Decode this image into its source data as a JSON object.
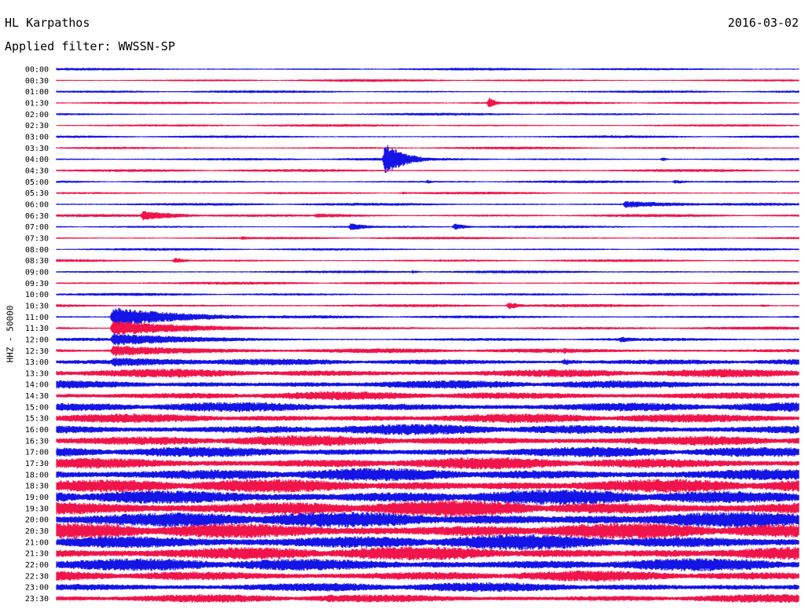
{
  "header": {
    "station": "HL Karpathos",
    "date": "2016-03-02",
    "filter_label": "Applied filter: WWSSN-SP"
  },
  "channel_label": "HHZ - 50000",
  "colors": {
    "trace_a": "#1414e6",
    "trace_b": "#f0144b",
    "background": "#ffffff"
  },
  "chart_data": {
    "type": "line",
    "subtype": "helicorder",
    "title": "HL Karpathos",
    "ylabel": "HHZ - 50000",
    "row_interval_minutes": 30,
    "series": [
      {
        "values": [
          {
            "time": "00:00",
            "amplitude": 0.25,
            "events": []
          },
          {
            "time": "00:30",
            "amplitude": 0.25,
            "events": []
          },
          {
            "time": "01:00",
            "amplitude": 0.25,
            "events": []
          },
          {
            "time": "01:30",
            "amplitude": 0.25,
            "events": [
              {
                "minute": 17.5,
                "peak": 1.4,
                "duration": 0.3
              }
            ]
          },
          {
            "time": "02:00",
            "amplitude": 0.25,
            "events": []
          },
          {
            "time": "02:30",
            "amplitude": 0.25,
            "events": []
          },
          {
            "time": "03:00",
            "amplitude": 0.25,
            "events": []
          },
          {
            "time": "03:30",
            "amplitude": 0.25,
            "events": []
          },
          {
            "time": "04:00",
            "amplitude": 0.28,
            "events": [
              {
                "minute": 13.3,
                "peak": 4.2,
                "duration": 0.8
              },
              {
                "minute": 24.5,
                "peak": 0.5,
                "duration": 0.3
              }
            ]
          },
          {
            "time": "04:30",
            "amplitude": 0.28,
            "events": []
          },
          {
            "time": "05:00",
            "amplitude": 0.25,
            "events": [
              {
                "minute": 15.0,
                "peak": 0.5,
                "duration": 0.3
              },
              {
                "minute": 25.0,
                "peak": 0.5,
                "duration": 0.8
              }
            ]
          },
          {
            "time": "05:30",
            "amplitude": 0.25,
            "events": [
              {
                "minute": 9.0,
                "peak": 0.35,
                "duration": 0.8
              },
              {
                "minute": 14.0,
                "peak": 0.35,
                "duration": 0.8
              }
            ]
          },
          {
            "time": "06:00",
            "amplitude": 0.28,
            "events": [
              {
                "minute": 23.0,
                "peak": 0.9,
                "duration": 3.0
              }
            ]
          },
          {
            "time": "06:30",
            "amplitude": 0.28,
            "events": [
              {
                "minute": 3.5,
                "peak": 1.3,
                "duration": 1.5
              },
              {
                "minute": 10.5,
                "peak": 0.6,
                "duration": 2.5
              }
            ]
          },
          {
            "time": "07:00",
            "amplitude": 0.25,
            "events": [
              {
                "minute": 11.9,
                "peak": 1.0,
                "duration": 0.8
              },
              {
                "minute": 16.1,
                "peak": 0.9,
                "duration": 0.6
              }
            ]
          },
          {
            "time": "07:30",
            "amplitude": 0.25,
            "events": [
              {
                "minute": 7.5,
                "peak": 0.5,
                "duration": 0.6
              }
            ]
          },
          {
            "time": "08:00",
            "amplitude": 0.25,
            "events": []
          },
          {
            "time": "08:30",
            "amplitude": 0.25,
            "events": [
              {
                "minute": 4.8,
                "peak": 0.8,
                "duration": 0.5
              }
            ]
          },
          {
            "time": "09:00",
            "amplitude": 0.28,
            "events": [
              {
                "minute": 14.4,
                "peak": 0.45,
                "duration": 0.4
              }
            ]
          },
          {
            "time": "09:30",
            "amplitude": 0.28,
            "events": []
          },
          {
            "time": "10:00",
            "amplitude": 0.28,
            "events": []
          },
          {
            "time": "10:30",
            "amplitude": 0.3,
            "events": [
              {
                "minute": 18.3,
                "peak": 1.0,
                "duration": 0.5
              },
              {
                "minute": 28.5,
                "peak": 0.4,
                "duration": 0.5
              }
            ]
          },
          {
            "time": "11:00",
            "amplitude": 0.3,
            "events": [
              {
                "minute": 2.3,
                "peak": 2.5,
                "duration": 3.0
              }
            ]
          },
          {
            "time": "11:30",
            "amplitude": 0.3,
            "events": [
              {
                "minute": 2.3,
                "peak": 2.0,
                "duration": 3.5
              }
            ]
          },
          {
            "time": "12:00",
            "amplitude": 0.3,
            "events": [
              {
                "minute": 2.3,
                "peak": 1.6,
                "duration": 4.0
              },
              {
                "minute": 22.8,
                "peak": 0.8,
                "duration": 1.0
              }
            ]
          },
          {
            "time": "12:30",
            "amplitude": 0.45,
            "events": [
              {
                "minute": 2.3,
                "peak": 1.4,
                "duration": 4.5
              },
              {
                "minute": 20.5,
                "peak": 0.8,
                "duration": 1.0
              }
            ]
          },
          {
            "time": "13:00",
            "amplitude": 0.6,
            "events": [
              {
                "minute": 2.3,
                "peak": 1.2,
                "duration": 5.0
              },
              {
                "minute": 20.5,
                "peak": 0.8,
                "duration": 1.0
              }
            ]
          },
          {
            "time": "13:30",
            "amplitude": 0.8,
            "events": []
          },
          {
            "time": "14:00",
            "amplitude": 0.8,
            "events": []
          },
          {
            "time": "14:30",
            "amplitude": 0.8,
            "events": []
          },
          {
            "time": "15:00",
            "amplitude": 0.9,
            "events": []
          },
          {
            "time": "15:30",
            "amplitude": 0.9,
            "events": []
          },
          {
            "time": "16:00",
            "amplitude": 1.0,
            "events": []
          },
          {
            "time": "16:30",
            "amplitude": 1.0,
            "events": []
          },
          {
            "time": "17:00",
            "amplitude": 1.0,
            "events": []
          },
          {
            "time": "17:30",
            "amplitude": 1.1,
            "events": []
          },
          {
            "time": "18:00",
            "amplitude": 1.2,
            "events": []
          },
          {
            "time": "18:30",
            "amplitude": 1.3,
            "events": []
          },
          {
            "time": "19:00",
            "amplitude": 1.4,
            "events": []
          },
          {
            "time": "19:30",
            "amplitude": 1.5,
            "events": []
          },
          {
            "time": "20:00",
            "amplitude": 1.5,
            "events": []
          },
          {
            "time": "20:30",
            "amplitude": 1.5,
            "events": []
          },
          {
            "time": "21:00",
            "amplitude": 1.4,
            "events": []
          },
          {
            "time": "21:30",
            "amplitude": 1.3,
            "events": []
          },
          {
            "time": "22:00",
            "amplitude": 1.2,
            "events": []
          },
          {
            "time": "22:30",
            "amplitude": 1.0,
            "events": []
          },
          {
            "time": "23:00",
            "amplitude": 0.9,
            "events": []
          },
          {
            "time": "23:30",
            "amplitude": 0.8,
            "events": [
              {
                "minute": 11.0,
                "peak": 1.3,
                "duration": 0.5
              }
            ]
          }
        ]
      }
    ],
    "grid": false,
    "legend": "none"
  }
}
